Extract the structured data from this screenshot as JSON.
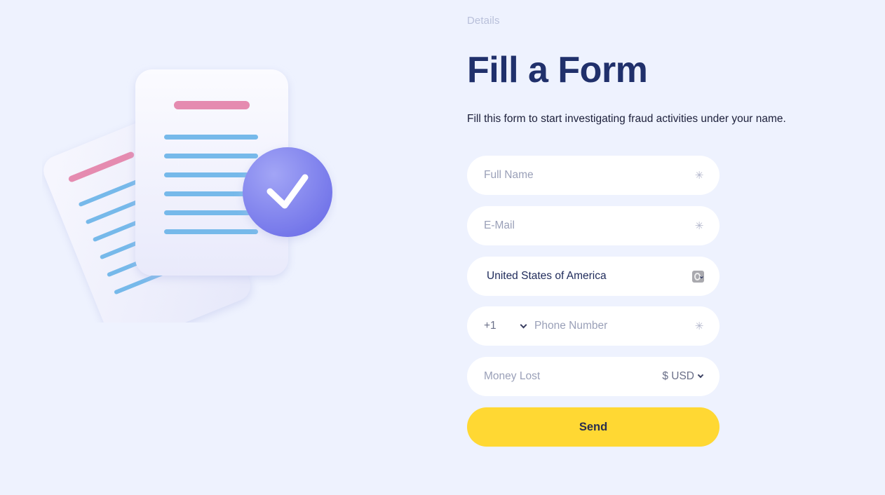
{
  "header": {
    "eyebrow": "Details",
    "title": "Fill a Form",
    "subtitle": "Fill this form to start investigating fraud activities under your name."
  },
  "illustration": {
    "icon": "documents-with-checkmark-icon",
    "colors": {
      "paper": "#f4f5fd",
      "title_line": "#e58bb0",
      "text_line": "#76b9ea",
      "badge": "#7c7ff0",
      "check": "#ffffff"
    }
  },
  "form": {
    "full_name": {
      "placeholder": "Full Name",
      "value": "",
      "required_mark": "✳"
    },
    "email": {
      "placeholder": "E-Mail",
      "value": "",
      "required_mark": "✳"
    },
    "country": {
      "selected": "United States of America"
    },
    "phone": {
      "country_code": "+1",
      "placeholder": "Phone Number",
      "value": "",
      "required_mark": "✳"
    },
    "money_lost": {
      "placeholder": "Money Lost",
      "value": "",
      "currency": "$ USD"
    },
    "submit_label": "Send"
  },
  "colors": {
    "background": "#eef2fe",
    "title": "#20306b",
    "eyebrow": "#b9c0da",
    "field_bg": "#ffffff",
    "button": "#ffd833",
    "button_text": "#2a2f4e"
  }
}
